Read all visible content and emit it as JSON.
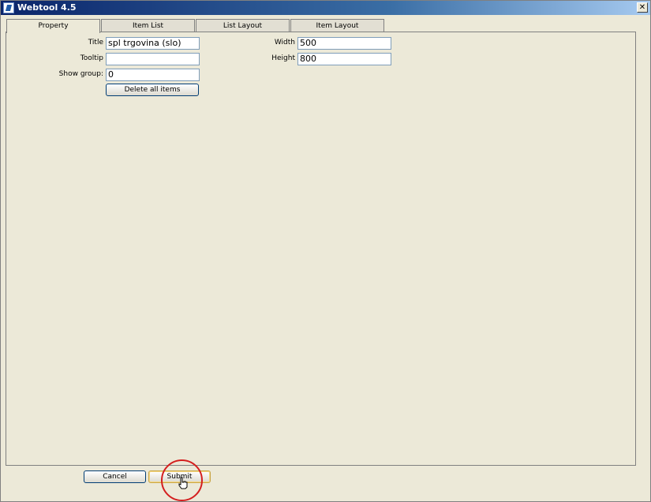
{
  "window": {
    "title": "Webtool 4.5",
    "close_symbol": "✕"
  },
  "tabs": [
    {
      "label": "Property",
      "active": true
    },
    {
      "label": "Item List",
      "active": false
    },
    {
      "label": "List Layout",
      "active": false
    },
    {
      "label": "Item Layout",
      "active": false
    }
  ],
  "form": {
    "title_label": "Title",
    "title_value": "spl trgovina (slo)",
    "tooltip_label": "Tooltip",
    "tooltip_value": "",
    "show_group_label": "Show group:",
    "show_group_value": "0",
    "delete_all_label": "Delete all items",
    "width_label": "Width",
    "width_value": "500",
    "height_label": "Height",
    "height_value": "800"
  },
  "footer": {
    "cancel_label": "Cancel",
    "submit_label": "Submit"
  },
  "annotation": {
    "highlight_color": "#d41f1f"
  },
  "icons": {
    "app": "webtool-app-icon",
    "cursor": "hand-pointer-icon"
  }
}
